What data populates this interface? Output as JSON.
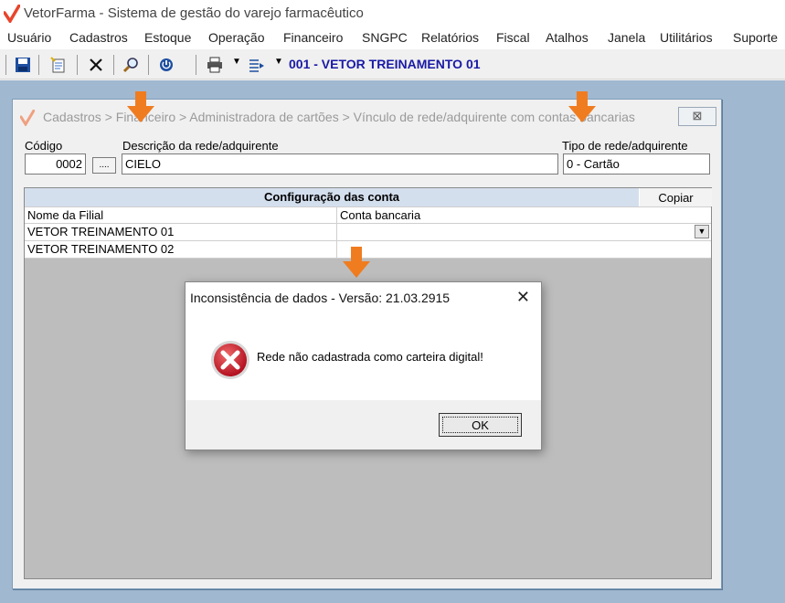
{
  "app": {
    "title": "VetorFarma - Sistema de gestão do varejo farmacêutico",
    "menu": [
      "Usuário",
      "Cadastros",
      "Estoque",
      "Operação",
      "Financeiro",
      "SNGPC",
      "Relatórios",
      "Fiscal",
      "Atalhos",
      "Janela",
      "Utilitários",
      "Suporte"
    ]
  },
  "toolbar": {
    "store": "001 - VETOR TREINAMENTO 01",
    "icons": [
      "save-icon",
      "new-document-icon",
      "close-icon",
      "search-icon",
      "power-icon",
      "printer-icon",
      "list-icon"
    ]
  },
  "form": {
    "breadcrumb": "Cadastros > Financeiro > Administradora de cartões > Vínculo de rede/adquirente com contas bancarias",
    "close_label": "⊠",
    "codigo_label": "Código",
    "codigo_value": "0002",
    "lookup_label": "....",
    "descricao_label": "Descrição da rede/adquirente",
    "descricao_value": "CIELO",
    "tipo_label": "Tipo de rede/adquirente",
    "tipo_value": "0 - Cartão"
  },
  "grid": {
    "header": "Configuração das conta",
    "copy_label": "Copiar",
    "columns": [
      "Nome da Filial",
      "Conta bancaria"
    ],
    "rows": [
      {
        "filial": "VETOR TREINAMENTO 01",
        "conta": ""
      },
      {
        "filial": "VETOR TREINAMENTO 02",
        "conta": ""
      }
    ]
  },
  "dialog": {
    "title": "Inconsistência de dados - Versão: 21.03.2915",
    "close_glyph": "✕",
    "message": "Rede não cadastrada como carteira digital!",
    "ok_label": "OK"
  },
  "colors": {
    "accent": "#1a1aa6",
    "arrow": "#f07c20",
    "error_red": "#c8102e",
    "mdi_background": "#a0b8d0"
  }
}
